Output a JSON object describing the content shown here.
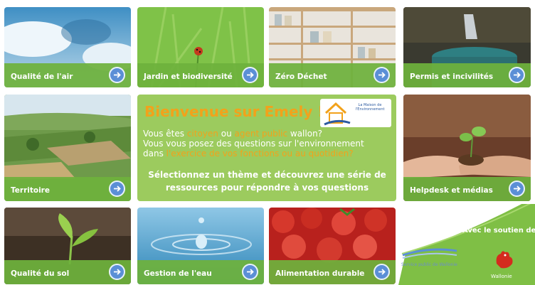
{
  "tiles": {
    "air": {
      "label": "Qualité de l'air"
    },
    "jardin": {
      "label": "Jardin et biodiversité"
    },
    "zero": {
      "label": "Zéro Déchet"
    },
    "permis": {
      "label": "Permis et incivilités"
    },
    "territoire": {
      "label": "Territoire"
    },
    "helpdesk": {
      "label": "Helpdesk et médias"
    },
    "sol": {
      "label": "Qualité du sol"
    },
    "eau": {
      "label": "Gestion de l'eau"
    },
    "alimentation": {
      "label": "Alimentation durable"
    }
  },
  "welcome": {
    "title": "Bienvenue sur Emely !",
    "line1_a": "Vous êtes ",
    "line1_citizen": "citoyen",
    "line1_b": " ou ",
    "line1_agent": "agent public",
    "line1_c": " wallon?",
    "line2": "Vous vous posez des questions sur l'environnement",
    "line3_a": "dans ",
    "line3_hl": "l'exercice de vos fonctions",
    "line3_b": " ou au quotidien?",
    "cta": "Sélectionnez un thème et découvrez une série de ressources pour répondre à vos questions",
    "logo_text": "La Maison de l'Environnement"
  },
  "partners": {
    "support_text": "Avec le soutien de",
    "spw_text": "Service public de Wallonie",
    "wallonie_text": "Wallonie"
  },
  "colors": {
    "label_bar": "#6eb23c",
    "arrow_button": "#5b8fd6",
    "welcome_bg": "#9ccb5e",
    "highlight": "#f2a21b",
    "partner_green": "#7fbf45"
  }
}
